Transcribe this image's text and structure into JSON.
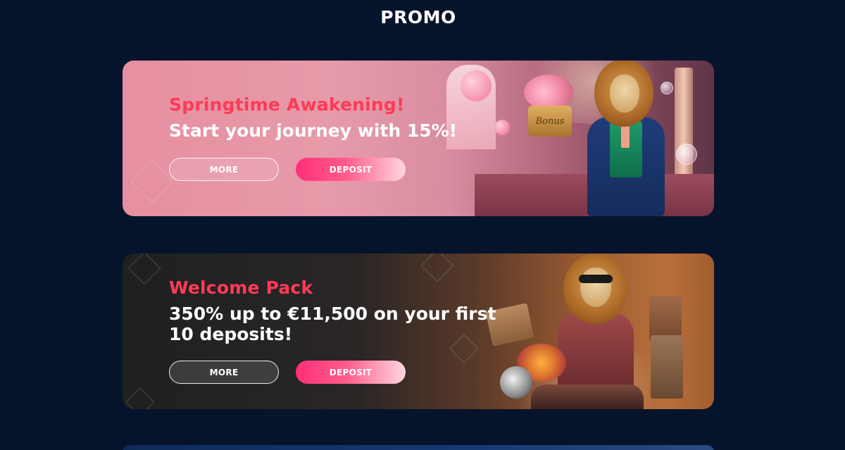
{
  "page": {
    "title": "PROMO"
  },
  "promos": [
    {
      "name": "Springtime Awakening!",
      "description": "Start your journey with 15%!",
      "more_label": "MORE",
      "deposit_label": "DEPOSIT",
      "bonus_box_label": "Bonus"
    },
    {
      "name": "Welcome Pack",
      "description": "350% up to €11,500 on your first 10 deposits!",
      "more_label": "MORE",
      "deposit_label": "DEPOSIT"
    }
  ],
  "colors": {
    "background": "#06142b",
    "promo_name": "#ff3b57",
    "deposit_gradient_start": "#ff2f7a",
    "deposit_gradient_end": "#ffd6de"
  }
}
